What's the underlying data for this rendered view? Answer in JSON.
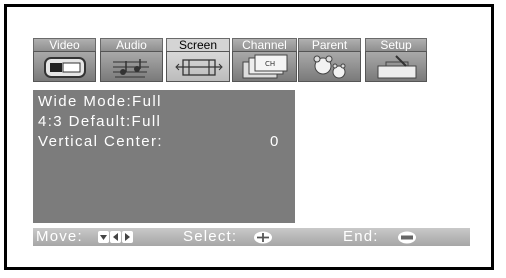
{
  "tabs": [
    {
      "label": "Video",
      "active": false,
      "icon": "video-tv-icon"
    },
    {
      "label": "Audio",
      "active": false,
      "icon": "audio-notes-icon"
    },
    {
      "label": "Screen",
      "active": true,
      "icon": "screen-adjust-icon"
    },
    {
      "label": "Channel",
      "active": false,
      "icon": "channel-ch-icon"
    },
    {
      "label": "Parent",
      "active": false,
      "icon": "parent-bears-icon"
    },
    {
      "label": "Setup",
      "active": false,
      "icon": "setup-toolbox-icon"
    }
  ],
  "menu": {
    "rows": [
      {
        "text": "Wide Mode:Full",
        "value": ""
      },
      {
        "text": "4:3 Default:Full",
        "value": ""
      },
      {
        "text": "Vertical Center:",
        "value": "0"
      }
    ]
  },
  "statusbar": {
    "move_label": "Move:",
    "select_label": "Select:",
    "end_label": "End:",
    "move_icon": "nav-arrows-icon",
    "select_icon": "select-cross-icon",
    "end_icon": "menu-button-icon"
  },
  "colors": {
    "panel": "#7c7c7c",
    "active_tab": "#d4d4d4",
    "inactive_tab": "#9e9e9e",
    "text": "#ffffff"
  }
}
